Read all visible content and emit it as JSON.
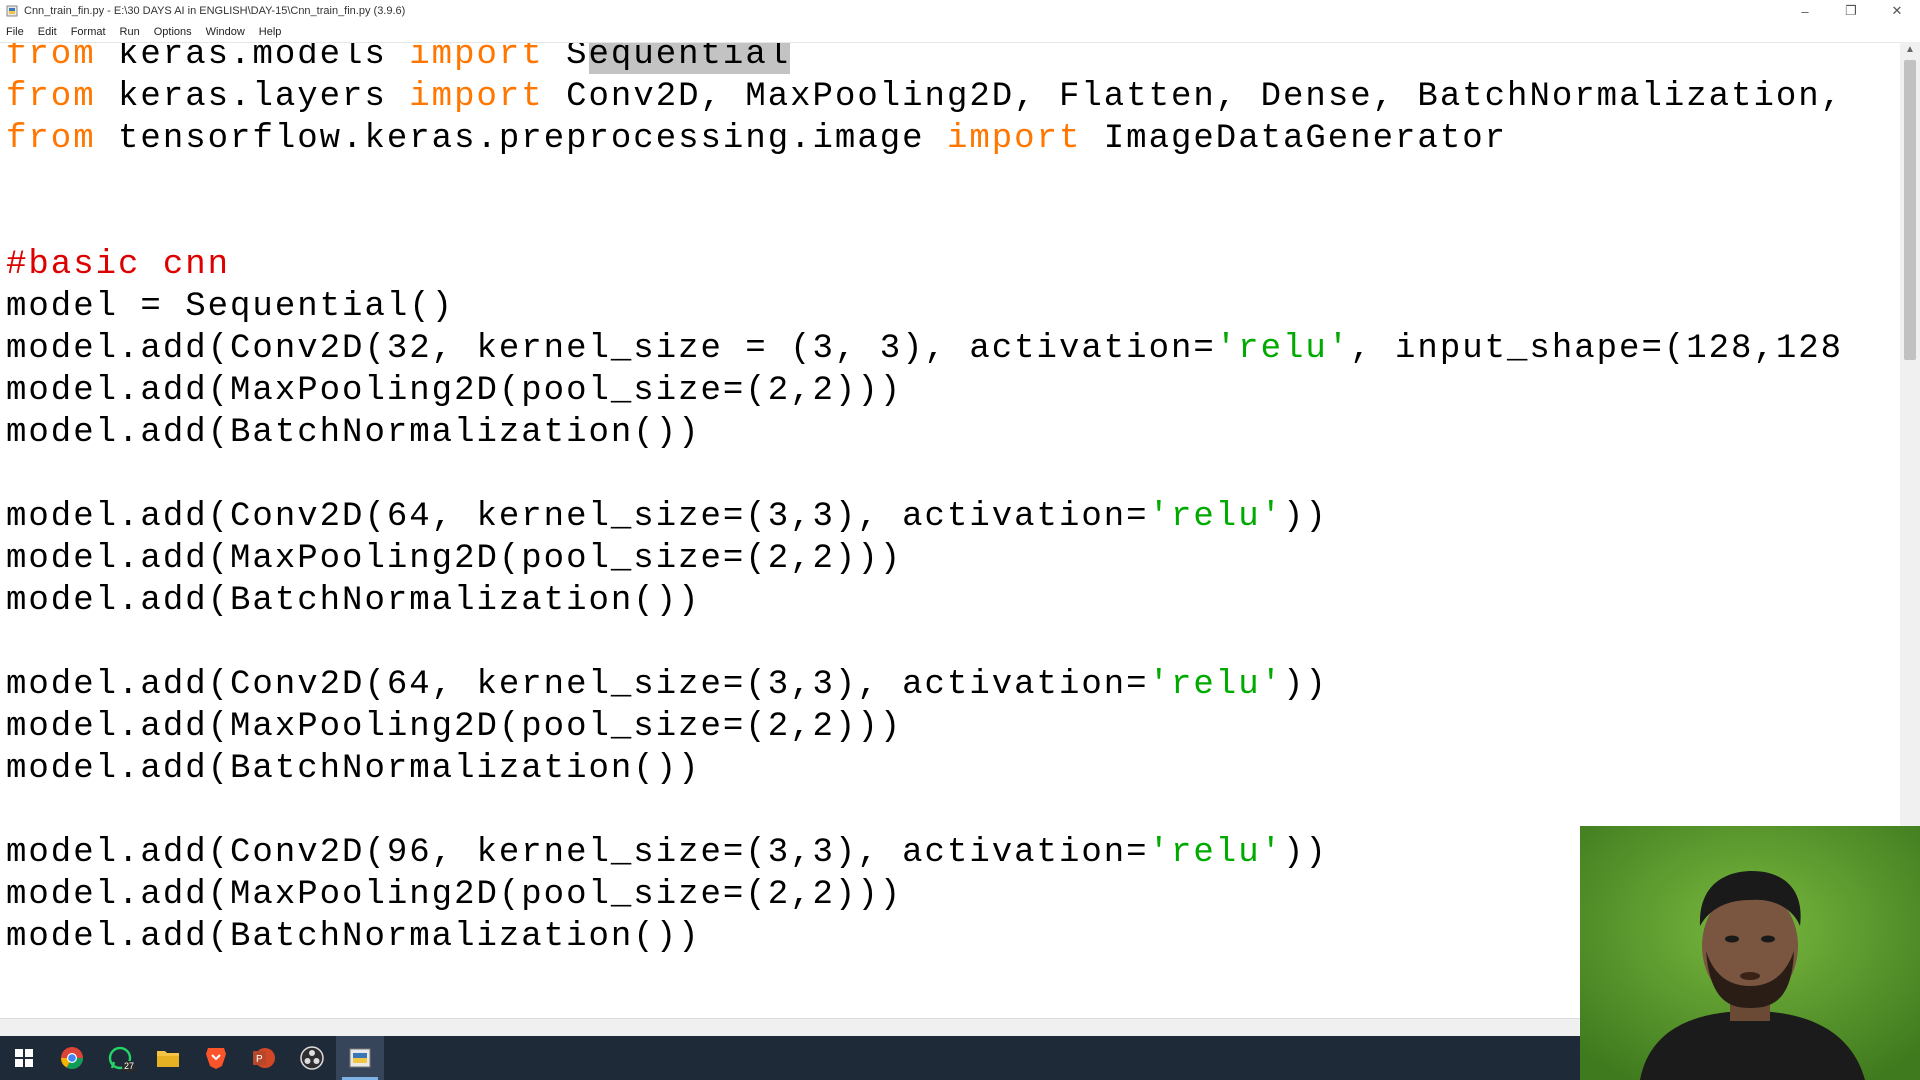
{
  "window": {
    "title": "Cnn_train_fin.py - E:\\30 DAYS AI in ENGLISH\\DAY-15\\Cnn_train_fin.py (3.9.6)",
    "controls": {
      "minimize": "–",
      "restore": "❐",
      "close": "✕"
    }
  },
  "menu": [
    "File",
    "Edit",
    "Format",
    "Run",
    "Options",
    "Window",
    "Help"
  ],
  "editor": {
    "lines": [
      {
        "segments": [
          {
            "t": "from",
            "c": "kw"
          },
          {
            "t": " keras.models ",
            "c": ""
          },
          {
            "t": "import",
            "c": "kw"
          },
          {
            "t": " S",
            "c": ""
          },
          {
            "t": "equential",
            "c": "sel"
          }
        ]
      },
      {
        "segments": [
          {
            "t": "from",
            "c": "kw"
          },
          {
            "t": " keras.layers ",
            "c": ""
          },
          {
            "t": "import",
            "c": "kw"
          },
          {
            "t": " Conv2D, MaxPooling2D, Flatten, Dense, BatchNormalization,",
            "c": ""
          }
        ]
      },
      {
        "segments": [
          {
            "t": "from",
            "c": "kw"
          },
          {
            "t": " tensorflow.keras.preprocessing.image ",
            "c": ""
          },
          {
            "t": "import",
            "c": "kw"
          },
          {
            "t": " ImageDataGenerator",
            "c": ""
          }
        ]
      },
      {
        "segments": []
      },
      {
        "segments": []
      },
      {
        "segments": [
          {
            "t": "#basic cnn",
            "c": "cm"
          }
        ]
      },
      {
        "segments": [
          {
            "t": "model = Sequential()",
            "c": ""
          }
        ]
      },
      {
        "segments": [
          {
            "t": "model.add(Conv2D(32, kernel_size = (3, 3), activation=",
            "c": ""
          },
          {
            "t": "'relu'",
            "c": "st"
          },
          {
            "t": ", input_shape=(128,128",
            "c": ""
          }
        ]
      },
      {
        "segments": [
          {
            "t": "model.add(MaxPooling2D(pool_size=(2,2)))",
            "c": ""
          }
        ]
      },
      {
        "segments": [
          {
            "t": "model.add(BatchNormalization())",
            "c": ""
          }
        ]
      },
      {
        "segments": []
      },
      {
        "segments": [
          {
            "t": "model.add(Conv2D(64, kernel_size=(3,3), activation=",
            "c": ""
          },
          {
            "t": "'relu'",
            "c": "st"
          },
          {
            "t": "))",
            "c": ""
          }
        ]
      },
      {
        "segments": [
          {
            "t": "model.add(MaxPooling2D(pool_size=(2,2)))",
            "c": ""
          }
        ]
      },
      {
        "segments": [
          {
            "t": "model.add(BatchNormalization())",
            "c": ""
          }
        ]
      },
      {
        "segments": []
      },
      {
        "segments": [
          {
            "t": "model.add(Conv2D(64, kernel_size=(3,3), activation=",
            "c": ""
          },
          {
            "t": "'relu'",
            "c": "st"
          },
          {
            "t": "))",
            "c": ""
          }
        ]
      },
      {
        "segments": [
          {
            "t": "model.add(MaxPooling2D(pool_size=(2,2)))",
            "c": ""
          }
        ]
      },
      {
        "segments": [
          {
            "t": "model.add(BatchNormalization())",
            "c": ""
          }
        ]
      },
      {
        "segments": []
      },
      {
        "segments": [
          {
            "t": "model.add(Conv2D(96, kernel_size=(3,3), activation=",
            "c": ""
          },
          {
            "t": "'relu'",
            "c": "st"
          },
          {
            "t": "))",
            "c": ""
          }
        ]
      },
      {
        "segments": [
          {
            "t": "model.add(MaxPooling2D(pool_size=(2,2)))",
            "c": ""
          }
        ]
      },
      {
        "segments": [
          {
            "t": "model.add(BatchNormalization())",
            "c": ""
          }
        ]
      }
    ]
  },
  "colors": {
    "keyword": "#ff7700",
    "comment": "#dd0000",
    "string": "#00aa00",
    "selection": "#c3c3c3",
    "taskbar": "#1f2a38"
  },
  "taskbar": {
    "items": [
      {
        "name": "start-button",
        "icon": "windows-icon"
      },
      {
        "name": "taskbar-chrome",
        "icon": "chrome-icon"
      },
      {
        "name": "taskbar-whatsapp",
        "icon": "whatsapp-icon",
        "badge": "27"
      },
      {
        "name": "taskbar-file-explorer",
        "icon": "folder-icon"
      },
      {
        "name": "taskbar-brave",
        "icon": "brave-icon"
      },
      {
        "name": "taskbar-powerpoint",
        "icon": "powerpoint-icon"
      },
      {
        "name": "taskbar-obs",
        "icon": "obs-icon"
      },
      {
        "name": "taskbar-idle",
        "icon": "python-idle-icon",
        "active": true
      }
    ]
  }
}
